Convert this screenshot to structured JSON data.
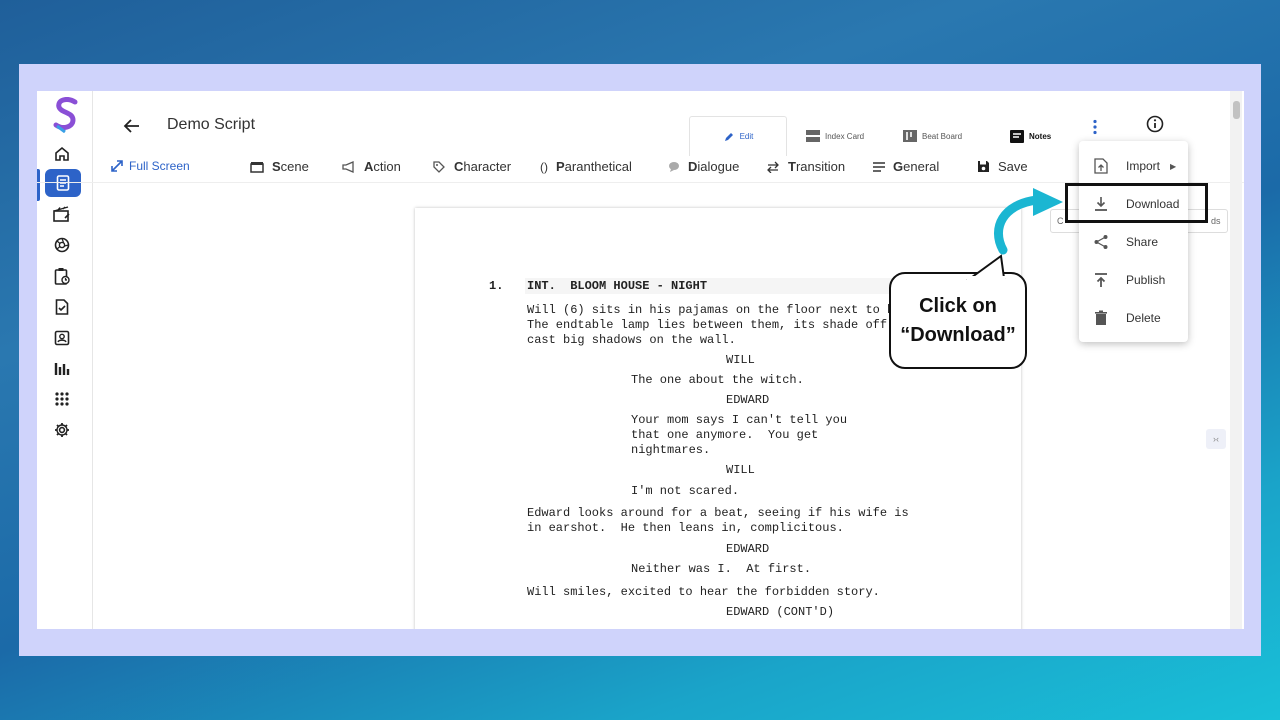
{
  "app": {
    "title": "Demo Script"
  },
  "tabs": [
    {
      "label": "Edit",
      "icon": "edit-pen-icon",
      "active": true
    },
    {
      "label": "Index Card",
      "icon": "index-card-icon"
    },
    {
      "label": "Beat Board",
      "icon": "beat-board-icon"
    },
    {
      "label": "Notes",
      "icon": "notes-icon"
    }
  ],
  "toolbar": {
    "fullscreen": "Full Screen",
    "scene": {
      "u": "S",
      "rest": "cene"
    },
    "action": {
      "u": "A",
      "rest": "ction"
    },
    "character": {
      "u": "C",
      "rest": "haracter"
    },
    "parenthetical": {
      "u": "P",
      "rest": "aranthetical"
    },
    "dialogue": {
      "u": "D",
      "rest": "ialogue"
    },
    "transition": {
      "u": "T",
      "rest": "ransition"
    },
    "general": {
      "u": "G",
      "rest": "eneral"
    },
    "save": "Save"
  },
  "menu": {
    "items": [
      {
        "label": "Import",
        "icon": "import-icon",
        "has_submenu": true
      },
      {
        "label": "Download",
        "icon": "download-icon"
      },
      {
        "label": "Share",
        "icon": "share-icon"
      },
      {
        "label": "Publish",
        "icon": "publish-icon"
      },
      {
        "label": "Delete",
        "icon": "delete-icon"
      }
    ]
  },
  "callout": {
    "line1": "Click on",
    "line2": "“Download”"
  },
  "behind_chip": {
    "left": "C",
    "right": "ds"
  },
  "script": {
    "scene_number": "1.",
    "scene_heading": "INT.  BLOOM HOUSE - NIGHT",
    "lines": [
      "Will (6) sits in his pajamas on the floor next to him.",
      "The endtable lamp lies between them, its shade off to",
      "cast big shadows on the wall.",
      "WILL",
      "The one about the witch.",
      "EDWARD",
      "Your mom says I can't tell you",
      "that one anymore.  You get",
      "nightmares.",
      "WILL",
      "I'm not scared.",
      "Edward looks around for a beat, seeing if his wife is",
      "in earshot.  He then leans in, complicitous.",
      "EDWARD",
      "Neither was I.  At first.",
      "Will smiles, excited to hear the forbidden story.",
      "EDWARD (CONT'D)"
    ]
  },
  "colors": {
    "accent": "#2d63c8",
    "frame": "#cfd3fb",
    "arrow": "#1bb6d2"
  }
}
